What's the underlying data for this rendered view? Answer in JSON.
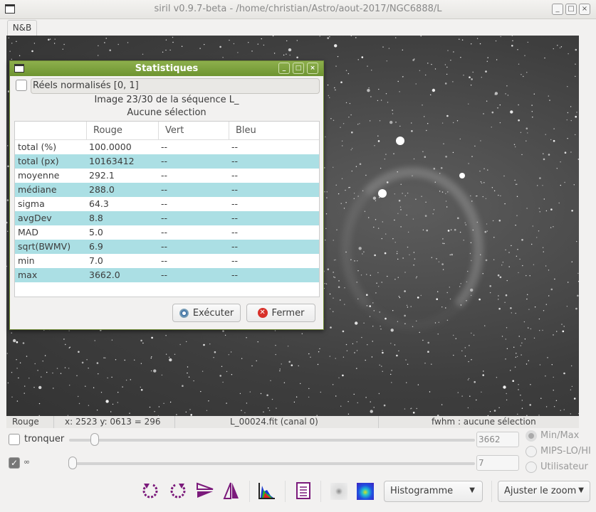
{
  "window": {
    "title": "siril v0.9.7-beta - /home/christian/Astro/aout-2017/NGC6888/L",
    "min": "_",
    "max": "□",
    "close": "×"
  },
  "tab": "N&B",
  "status": {
    "channel": "Rouge",
    "coords": "x: 2523 y: 0613 = 296",
    "file": "L_00024.fit (canal 0)",
    "fwhm": "fwhm : aucune sélection"
  },
  "controls": {
    "tronquer": "tronquer",
    "high_value": "3662",
    "low_value": "7",
    "radio": [
      "Min/Max",
      "MIPS-LO/HI",
      "Utilisateur"
    ],
    "display_mode": "Histogramme",
    "zoom": "Ajuster le zoom"
  },
  "dialog": {
    "title": "Statistiques",
    "normalized": "Réels normalisés [0, 1]",
    "image_info": "Image 23/30 de la séquence L_",
    "selection": "Aucune sélection",
    "columns": [
      "",
      "Rouge",
      "Vert",
      "Bleu"
    ],
    "rows": [
      [
        "total (%)",
        "100.0000",
        "--",
        "--"
      ],
      [
        "total (px)",
        "10163412",
        "--",
        "--"
      ],
      [
        "moyenne",
        "292.1",
        "--",
        "--"
      ],
      [
        "médiane",
        "288.0",
        "--",
        "--"
      ],
      [
        "sigma",
        "64.3",
        "--",
        "--"
      ],
      [
        "avgDev",
        "8.8",
        "--",
        "--"
      ],
      [
        "MAD",
        "5.0",
        "--",
        "--"
      ],
      [
        "sqrt(BWMV)",
        "6.9",
        "--",
        "--"
      ],
      [
        "min",
        "7.0",
        "--",
        "--"
      ],
      [
        "max",
        "3662.0",
        "--",
        "--"
      ]
    ],
    "execute": "Exécuter",
    "close": "Fermer"
  },
  "colors": {
    "accent": "#7a9e3b",
    "row_alt": "#abdfe4",
    "icon_purple": "#7b1a7b"
  }
}
